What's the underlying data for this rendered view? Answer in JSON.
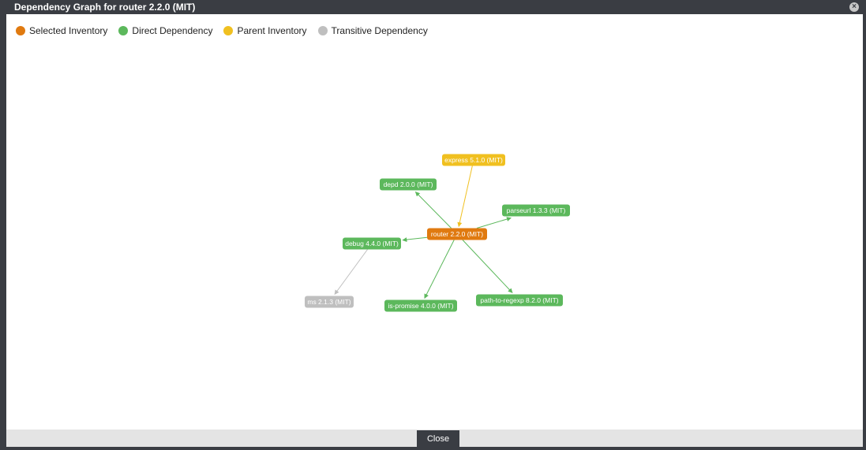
{
  "dialog": {
    "title": "Dependency Graph for router 2.2.0 (MIT)",
    "close_icon": "close-icon",
    "close_label": "Close"
  },
  "colors": {
    "selected": "#e07a10",
    "direct": "#5cb85c",
    "parent": "#f0c020",
    "transitive": "#bfbfbf",
    "titlebar": "#3a3d43"
  },
  "legend": [
    {
      "label": "Selected Inventory",
      "kind": "selected"
    },
    {
      "label": "Direct Dependency",
      "kind": "direct"
    },
    {
      "label": "Parent Inventory",
      "kind": "parent"
    },
    {
      "label": "Transitive Dependency",
      "kind": "transitive"
    }
  ],
  "graph": {
    "nodes": [
      {
        "id": "router",
        "label": "router 2.2.0 (MIT)",
        "kind": "selected"
      },
      {
        "id": "express",
        "label": "express 5.1.0 (MIT)",
        "kind": "parent"
      },
      {
        "id": "depd",
        "label": "depd 2.0.0 (MIT)",
        "kind": "direct"
      },
      {
        "id": "parseurl",
        "label": "parseurl 1.3.3 (MIT)",
        "kind": "direct"
      },
      {
        "id": "debug",
        "label": "debug 4.4.0 (MIT)",
        "kind": "direct"
      },
      {
        "id": "ms",
        "label": "ms 2.1.3 (MIT)",
        "kind": "transitive"
      },
      {
        "id": "is-promise",
        "label": "is-promise 4.0.0 (MIT)",
        "kind": "direct"
      },
      {
        "id": "path-to-regexp",
        "label": "path-to-regexp 8.2.0 (MIT)",
        "kind": "direct"
      }
    ],
    "edges": [
      {
        "from": "express",
        "to": "router"
      },
      {
        "from": "router",
        "to": "depd"
      },
      {
        "from": "router",
        "to": "parseurl"
      },
      {
        "from": "router",
        "to": "debug"
      },
      {
        "from": "router",
        "to": "is-promise"
      },
      {
        "from": "router",
        "to": "path-to-regexp"
      },
      {
        "from": "debug",
        "to": "ms"
      }
    ]
  }
}
